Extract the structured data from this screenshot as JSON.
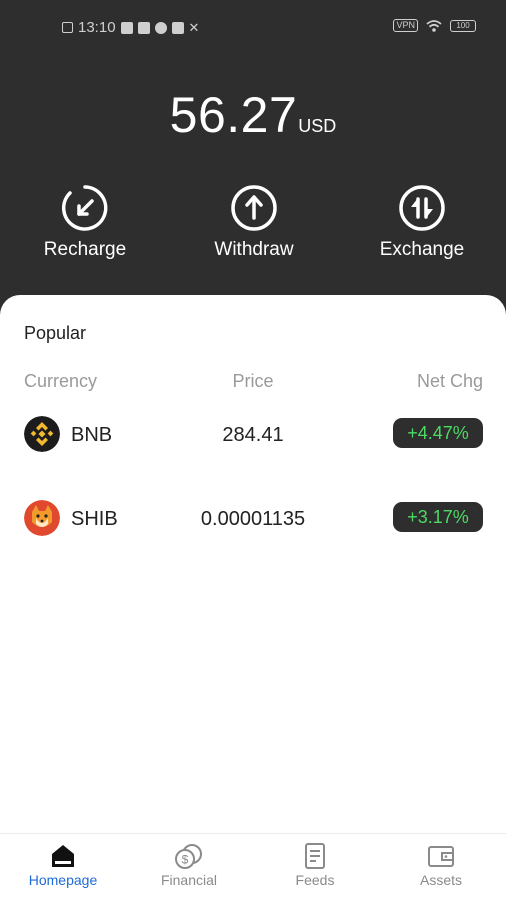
{
  "status_bar": {
    "time": "13:10",
    "vpn": "VPN",
    "battery": "100"
  },
  "balance": {
    "amount": "56.27",
    "currency": "USD"
  },
  "actions": [
    {
      "label": "Recharge",
      "icon": "recharge-icon"
    },
    {
      "label": "Withdraw",
      "icon": "withdraw-icon"
    },
    {
      "label": "Exchange",
      "icon": "exchange-icon"
    }
  ],
  "popular": {
    "title": "Popular",
    "columns": {
      "currency": "Currency",
      "price": "Price",
      "net_chg": "Net Chg"
    },
    "rows": [
      {
        "symbol": "BNB",
        "price": "284.41",
        "change": "+4.47%",
        "icon": "bnb-icon"
      },
      {
        "symbol": "SHIB",
        "price": "0.00001135",
        "change": "+3.17%",
        "icon": "shib-icon"
      }
    ]
  },
  "tabs": [
    {
      "label": "Homepage",
      "icon": "home-icon",
      "active": true
    },
    {
      "label": "Financial",
      "icon": "coins-icon",
      "active": false
    },
    {
      "label": "Feeds",
      "icon": "document-icon",
      "active": false
    },
    {
      "label": "Assets",
      "icon": "wallet-icon",
      "active": false
    }
  ],
  "colors": {
    "header_bg": "#2e2e2e",
    "positive": "#4cd964",
    "active_tab": "#1e6bd6",
    "bnb": "#f3ba2f",
    "shib": "#e0492e"
  }
}
